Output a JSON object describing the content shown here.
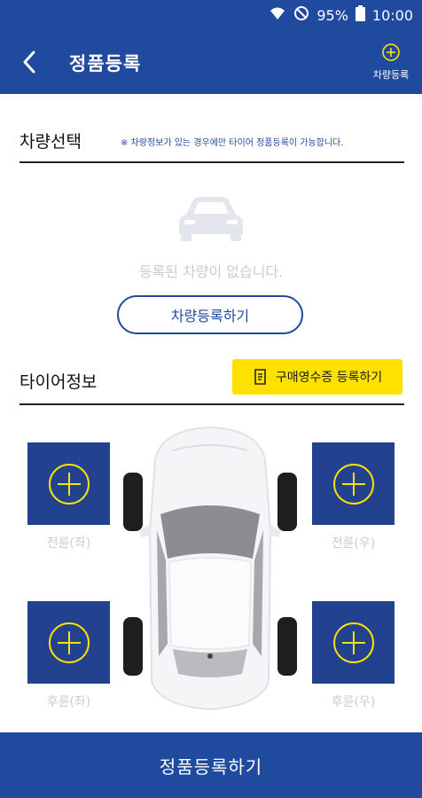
{
  "status_bar": {
    "battery": "95%",
    "time": "10:00",
    "icons": [
      "wifi-icon",
      "do-not-disturb-icon",
      "battery-icon"
    ]
  },
  "header": {
    "title": "정품등록",
    "add_vehicle_label": "차량등록"
  },
  "vehicle_section": {
    "title": "차량선택",
    "notice": "※ 차량정보가 있는 경우에만 타이어 정품등록이 가능합니다.",
    "empty_message": "등록된 차량이 없습니다.",
    "register_button": "차량등록하기"
  },
  "tire_section": {
    "title": "타이어정보",
    "receipt_button": "구매영수증 등록하기",
    "front_left": "전륜(좌)",
    "front_right": "전륜(우)",
    "rear_left": "후륜(좌)",
    "rear_right": "후륜(우)"
  },
  "footer": {
    "submit_button": "정품등록하기"
  },
  "colors": {
    "primary": "#1f4a9e",
    "accent_yellow": "#ffe100",
    "tire_box": "#22418f"
  }
}
